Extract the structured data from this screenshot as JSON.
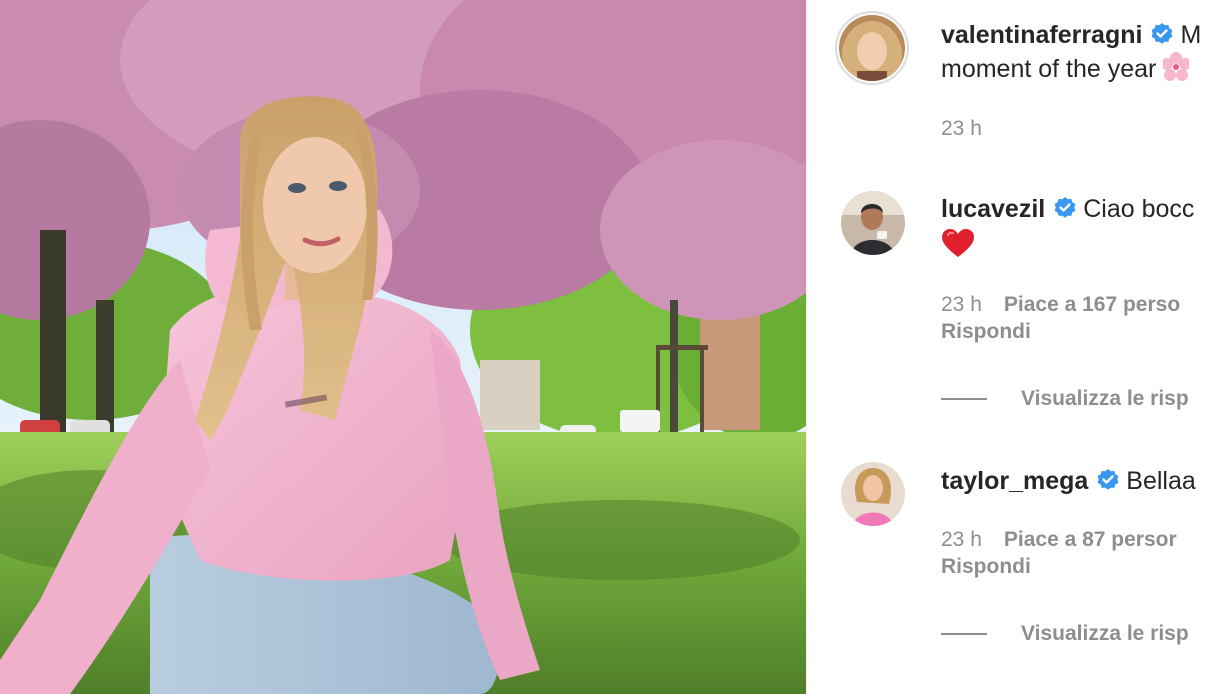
{
  "post": {
    "author": {
      "username": "valentinaferragni",
      "verified": true,
      "caption_start": "M",
      "caption_line2": "moment of the year",
      "caption_emoji": "cherry-blossom",
      "time": "23 h"
    }
  },
  "comments": [
    {
      "username": "lucavezil",
      "verified": true,
      "text": "Ciao bocc",
      "emoji": "red-heart",
      "time": "23 h",
      "likes": "Piace a 167 perso",
      "reply_label": "Rispondi",
      "view_replies_label": "Visualizza le risp"
    },
    {
      "username": "taylor_mega",
      "verified": true,
      "text": "Bellaa",
      "time": "23 h",
      "likes": "Piace a 87 persor",
      "reply_label": "Rispondi",
      "view_replies_label": "Visualizza le risp"
    }
  ],
  "colors": {
    "verified_blue": "#3897f0",
    "muted_text": "#8e8e8e",
    "primary_text": "#262626",
    "hoodie_pink": "#f2b6cf"
  }
}
